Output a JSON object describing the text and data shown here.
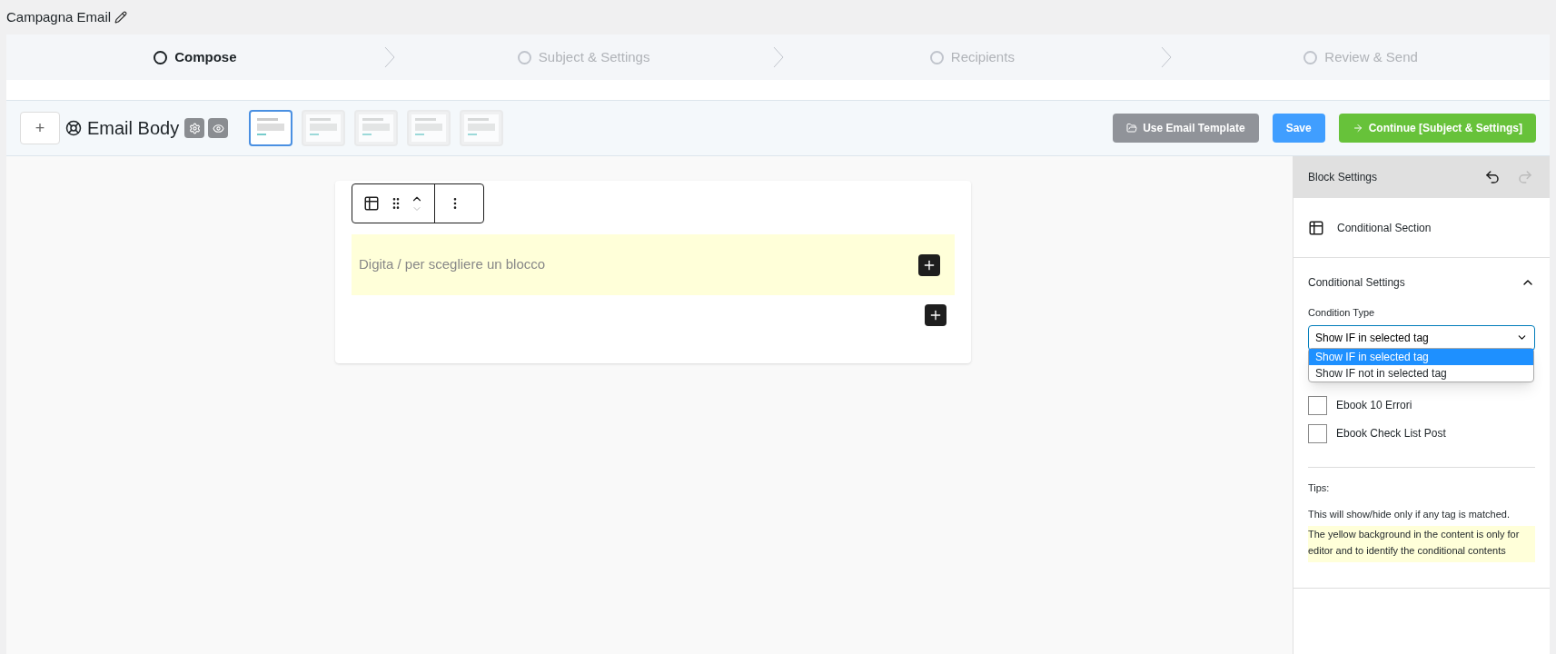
{
  "page_title": "Campagna Email",
  "steps": [
    {
      "label": "Compose",
      "selected": true
    },
    {
      "label": "Subject & Settings",
      "selected": false
    },
    {
      "label": "Recipients",
      "selected": false
    },
    {
      "label": "Review & Send",
      "selected": false
    }
  ],
  "toolbar": {
    "add": "+",
    "title": "Email Body",
    "templates": [
      {
        "selected": true
      },
      {
        "selected": false
      },
      {
        "selected": false
      },
      {
        "selected": false
      },
      {
        "selected": false
      }
    ],
    "buttons": [
      {
        "kind": "template",
        "label": "Use Email Template"
      },
      {
        "kind": "save",
        "label": "Save"
      },
      {
        "kind": "continue",
        "label": "Continue [Subject & Settings]"
      }
    ]
  },
  "editor": {
    "placeholder": "Digita / per scegliere un blocco"
  },
  "sidebar": {
    "header": "Block Settings",
    "block_name": "Conditional Section",
    "section_title": "Conditional Settings",
    "expanded": true,
    "condition_label": "Condition Type",
    "condition_value": "Show IF in selected tag",
    "options": [
      {
        "label": "Show IF in selected tag",
        "selected": true
      },
      {
        "label": "Show IF not in selected tag",
        "selected": false
      }
    ],
    "tags": [
      {
        "label": "Ebook 10 Errori",
        "checked": false
      },
      {
        "label": "Ebook Check List Post",
        "checked": false
      }
    ],
    "tips_title": "Tips:",
    "tips": "This will show/hide only if any tag is matched.",
    "note": "The yellow background in the content is only for editor and to identify the conditional contents"
  }
}
